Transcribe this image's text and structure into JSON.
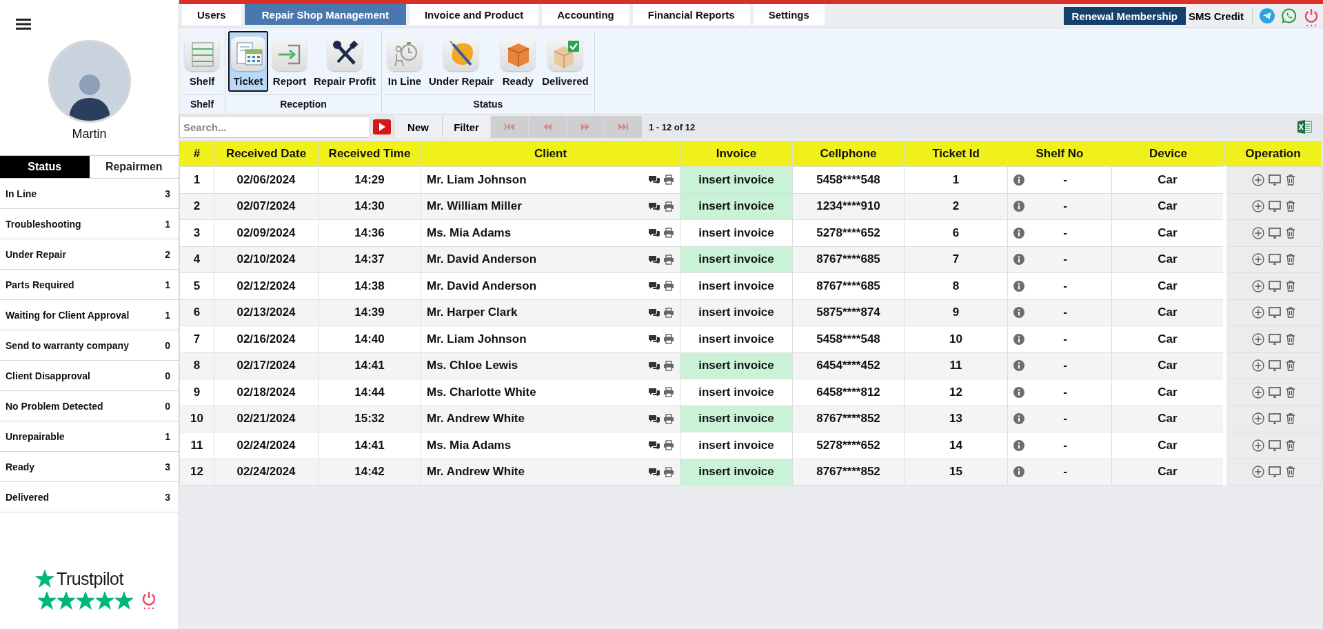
{
  "sidebar": {
    "user_name": "Martin",
    "tabs": [
      {
        "label": "Status",
        "selected": true
      },
      {
        "label": "Repairmen",
        "selected": false
      }
    ],
    "status_items": [
      {
        "label": "In Line",
        "count": "3"
      },
      {
        "label": "Troubleshooting",
        "count": "1"
      },
      {
        "label": "Under Repair",
        "count": "2"
      },
      {
        "label": "Parts Required",
        "count": "1"
      },
      {
        "label": "Waiting for Client Approval",
        "count": "1"
      },
      {
        "label": "Send to warranty company",
        "count": "0"
      },
      {
        "label": "Client Disapproval",
        "count": "0"
      },
      {
        "label": "No Problem Detected",
        "count": "0"
      },
      {
        "label": "Unrepairable",
        "count": "1"
      },
      {
        "label": "Ready",
        "count": "3"
      },
      {
        "label": "Delivered",
        "count": "3"
      }
    ],
    "rating": {
      "brand": "Trustpilot",
      "stars": 5
    }
  },
  "top_tabs": [
    {
      "label": "Users",
      "selected": false
    },
    {
      "label": "Repair Shop Management",
      "selected": true
    },
    {
      "label": "Invoice and Product",
      "selected": false
    },
    {
      "label": "Accounting",
      "selected": false
    },
    {
      "label": "Financial Reports",
      "selected": false
    },
    {
      "label": "Settings",
      "selected": false
    }
  ],
  "header_actions": {
    "renewal": "Renewal Membership",
    "sms_credit": "SMS Credit"
  },
  "ribbon": {
    "groups": [
      {
        "label": "Shelf",
        "items": [
          {
            "label": "Shelf",
            "kind": "shelf",
            "selected": false
          }
        ]
      },
      {
        "label": "Reception",
        "items": [
          {
            "label": "Ticket",
            "kind": "ticket",
            "selected": true
          },
          {
            "label": "Report",
            "kind": "report",
            "selected": false
          },
          {
            "label": "Repair Profit",
            "kind": "tools",
            "selected": false
          }
        ]
      },
      {
        "label": "Status",
        "items": [
          {
            "label": "In Line",
            "kind": "inline",
            "selected": false
          },
          {
            "label": "Under Repair",
            "kind": "repair",
            "selected": false
          },
          {
            "label": "Ready",
            "kind": "box",
            "selected": false
          },
          {
            "label": "Delivered",
            "kind": "boxcheck",
            "selected": false
          }
        ]
      }
    ]
  },
  "toolbar": {
    "search_placeholder": "Search...",
    "buttons": [
      "New",
      "Filter"
    ],
    "pager_disabled": true,
    "range": "1 - 12 of 12"
  },
  "table": {
    "columns": [
      "#",
      "Received Date",
      "Received Time",
      "Client",
      "Invoice",
      "Cellphone",
      "Ticket Id",
      "Shelf No",
      "Device",
      "Operation"
    ],
    "rows": [
      {
        "num": "1",
        "date": "02/06/2024",
        "time": "14:29",
        "client": "Mr. Liam Johnson",
        "invoice": "insert invoice",
        "invoice_highlighted": true,
        "cellphone": "5458****548",
        "ticket_id": "1",
        "shelf_no": "-",
        "device": "Car"
      },
      {
        "num": "2",
        "date": "02/07/2024",
        "time": "14:30",
        "client": "Mr. William Miller",
        "invoice": "insert invoice",
        "invoice_highlighted": true,
        "cellphone": "1234****910",
        "ticket_id": "2",
        "shelf_no": "-",
        "device": "Car"
      },
      {
        "num": "3",
        "date": "02/09/2024",
        "time": "14:36",
        "client": "Ms. Mia Adams",
        "invoice": "insert invoice",
        "invoice_highlighted": false,
        "cellphone": "5278****652",
        "ticket_id": "6",
        "shelf_no": "-",
        "device": "Car"
      },
      {
        "num": "4",
        "date": "02/10/2024",
        "time": "14:37",
        "client": "Mr. David Anderson",
        "invoice": "insert invoice",
        "invoice_highlighted": true,
        "cellphone": "8767****685",
        "ticket_id": "7",
        "shelf_no": "-",
        "device": "Car"
      },
      {
        "num": "5",
        "date": "02/12/2024",
        "time": "14:38",
        "client": "Mr. David Anderson",
        "invoice": "insert invoice",
        "invoice_highlighted": false,
        "cellphone": "8767****685",
        "ticket_id": "8",
        "shelf_no": "-",
        "device": "Car"
      },
      {
        "num": "6",
        "date": "02/13/2024",
        "time": "14:39",
        "client": "Mr. Harper Clark",
        "invoice": "insert invoice",
        "invoice_highlighted": false,
        "cellphone": "5875****874",
        "ticket_id": "9",
        "shelf_no": "-",
        "device": "Car"
      },
      {
        "num": "7",
        "date": "02/16/2024",
        "time": "14:40",
        "client": "Mr. Liam Johnson",
        "invoice": "insert invoice",
        "invoice_highlighted": false,
        "cellphone": "5458****548",
        "ticket_id": "10",
        "shelf_no": "-",
        "device": "Car"
      },
      {
        "num": "8",
        "date": "02/17/2024",
        "time": "14:41",
        "client": "Ms. Chloe Lewis",
        "invoice": "insert invoice",
        "invoice_highlighted": true,
        "cellphone": "6454****452",
        "ticket_id": "11",
        "shelf_no": "-",
        "device": "Car"
      },
      {
        "num": "9",
        "date": "02/18/2024",
        "time": "14:44",
        "client": "Ms. Charlotte White",
        "invoice": "insert invoice",
        "invoice_highlighted": false,
        "cellphone": "6458****812",
        "ticket_id": "12",
        "shelf_no": "-",
        "device": "Car"
      },
      {
        "num": "10",
        "date": "02/21/2024",
        "time": "15:32",
        "client": "Mr. Andrew White",
        "invoice": "insert invoice",
        "invoice_highlighted": true,
        "cellphone": "8767****852",
        "ticket_id": "13",
        "shelf_no": "-",
        "device": "Car"
      },
      {
        "num": "11",
        "date": "02/24/2024",
        "time": "14:41",
        "client": "Ms. Mia Adams",
        "invoice": "insert invoice",
        "invoice_highlighted": false,
        "cellphone": "5278****652",
        "ticket_id": "14",
        "shelf_no": "-",
        "device": "Car"
      },
      {
        "num": "12",
        "date": "02/24/2024",
        "time": "14:42",
        "client": "Mr. Andrew White",
        "invoice": "insert invoice",
        "invoice_highlighted": true,
        "cellphone": "8767****852",
        "ticket_id": "15",
        "shelf_no": "-",
        "device": "Car"
      }
    ]
  }
}
